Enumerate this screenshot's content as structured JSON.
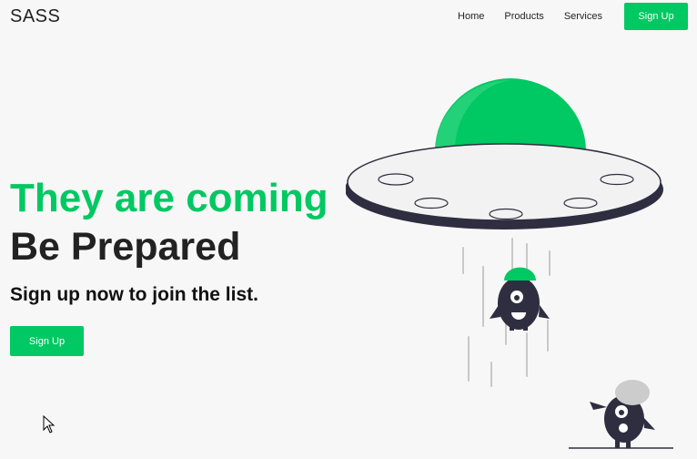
{
  "header": {
    "logo": "SASS",
    "nav": [
      {
        "label": "Home"
      },
      {
        "label": "Products"
      },
      {
        "label": "Services"
      }
    ],
    "signup_label": "Sign Up"
  },
  "hero": {
    "title": "They are coming",
    "subtitle": "Be Prepared",
    "tagline": "Sign up now to join the list.",
    "cta_label": "Sign Up"
  },
  "colors": {
    "accent": "#00c862",
    "dark": "#2f2e41",
    "text": "#222222",
    "background": "#f7f7f7"
  },
  "icons": {
    "illustration": "ufo-alien-illustration",
    "cursor": "mouse-pointer"
  }
}
